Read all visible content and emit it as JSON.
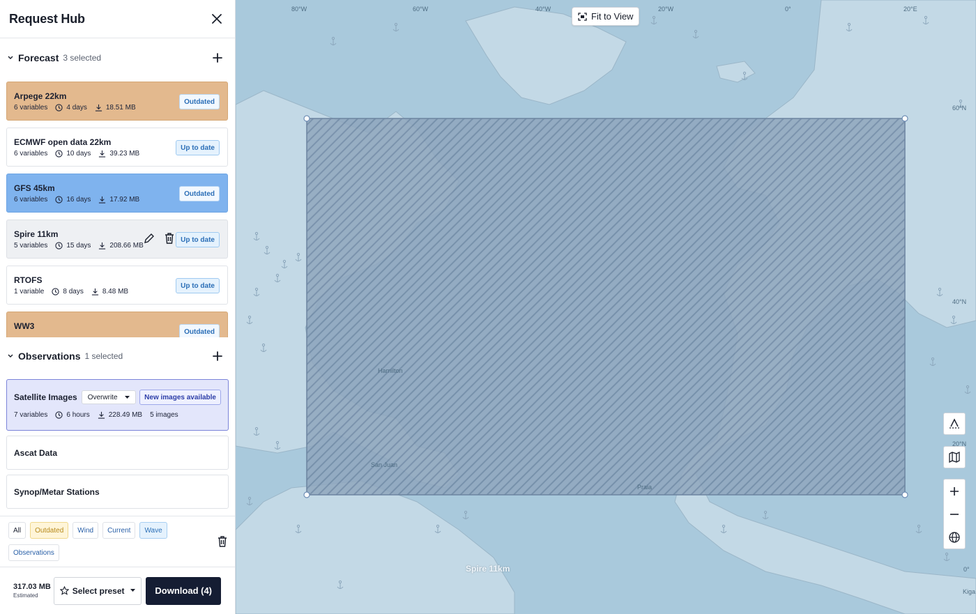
{
  "panel": {
    "title": "Request Hub",
    "forecast": {
      "title": "Forecast",
      "count": "3 selected",
      "items": [
        {
          "name": "Arpege 22km",
          "variables": "6 variables",
          "duration": "4 days",
          "size": "18.51 MB",
          "status": "Outdated"
        },
        {
          "name": "ECMWF open data 22km",
          "variables": "6 variables",
          "duration": "10 days",
          "size": "39.23 MB",
          "status": "Up to date"
        },
        {
          "name": "GFS 45km",
          "variables": "6 variables",
          "duration": "16 days",
          "size": "17.92 MB",
          "status": "Outdated"
        },
        {
          "name": "Spire 11km",
          "variables": "5 variables",
          "duration": "15 days",
          "size": "208.66 MB",
          "status": "Up to date"
        },
        {
          "name": "RTOFS",
          "variables": "1 variable",
          "duration": "8 days",
          "size": "8.48 MB",
          "status": "Up to date"
        },
        {
          "name": "WW3",
          "variables": "",
          "duration": "",
          "size": "",
          "status": "Outdated"
        }
      ]
    },
    "observations": {
      "title": "Observations",
      "count": "1 selected",
      "satellite": {
        "name": "Satellite Images",
        "mode": "Overwrite",
        "notice": "New images available",
        "variables": "7 variables",
        "duration": "6 hours",
        "size": "228.49 MB",
        "images": "5 images"
      },
      "ascat": "Ascat Data",
      "synop": "Synop/Metar Stations"
    },
    "filters": [
      "All",
      "Outdated",
      "Wind",
      "Current",
      "Wave",
      "Observations"
    ],
    "footer": {
      "estimate_size": "317.03 MB",
      "estimate_label": "Estimated",
      "preset_label": "Select preset",
      "download_label": "Download (4)"
    }
  },
  "map": {
    "fit_label": "Fit to View",
    "selection_label": "Spire 11km",
    "coords": {
      "lon_80w": "80°W",
      "lon_60w": "60°W",
      "lon_40w": "40°W",
      "lon_20w": "20°W",
      "lon_0": "0°",
      "lon_20e": "20°E",
      "lat_60n": "60°N",
      "lat_40n": "40°N",
      "lat_20n": "20°N",
      "lat_0": "0°"
    },
    "places": {
      "hamilton": "Hamilton",
      "san_juan": "San Juan",
      "praia": "Praia",
      "kigali": "Kiga"
    },
    "colors": {
      "sea": "#a9c9dc",
      "land": "#c3d9e6",
      "selection": "#7f96b0"
    }
  }
}
